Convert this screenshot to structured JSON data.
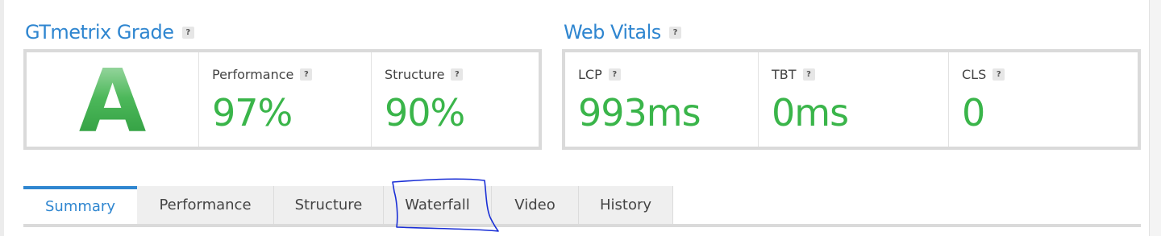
{
  "grade_section": {
    "title": "GTmetrix Grade",
    "help": "?",
    "grade": "A",
    "metrics": [
      {
        "label": "Performance",
        "help": "?",
        "value": "97%"
      },
      {
        "label": "Structure",
        "help": "?",
        "value": "90%"
      }
    ]
  },
  "vitals_section": {
    "title": "Web Vitals",
    "help": "?",
    "metrics": [
      {
        "label": "LCP",
        "help": "?",
        "value": "993ms"
      },
      {
        "label": "TBT",
        "help": "?",
        "value": "0ms"
      },
      {
        "label": "CLS",
        "help": "?",
        "value": "0"
      }
    ]
  },
  "tabs": [
    {
      "label": "Summary",
      "active": true
    },
    {
      "label": "Performance",
      "active": false
    },
    {
      "label": "Structure",
      "active": false
    },
    {
      "label": "Waterfall",
      "active": false
    },
    {
      "label": "Video",
      "active": false
    },
    {
      "label": "History",
      "active": false
    }
  ],
  "colors": {
    "accent": "#2f86d0",
    "metric_good": "#3ab54a",
    "annotation": "#1a2fd6"
  },
  "icons": {
    "help": "question-mark-icon"
  }
}
